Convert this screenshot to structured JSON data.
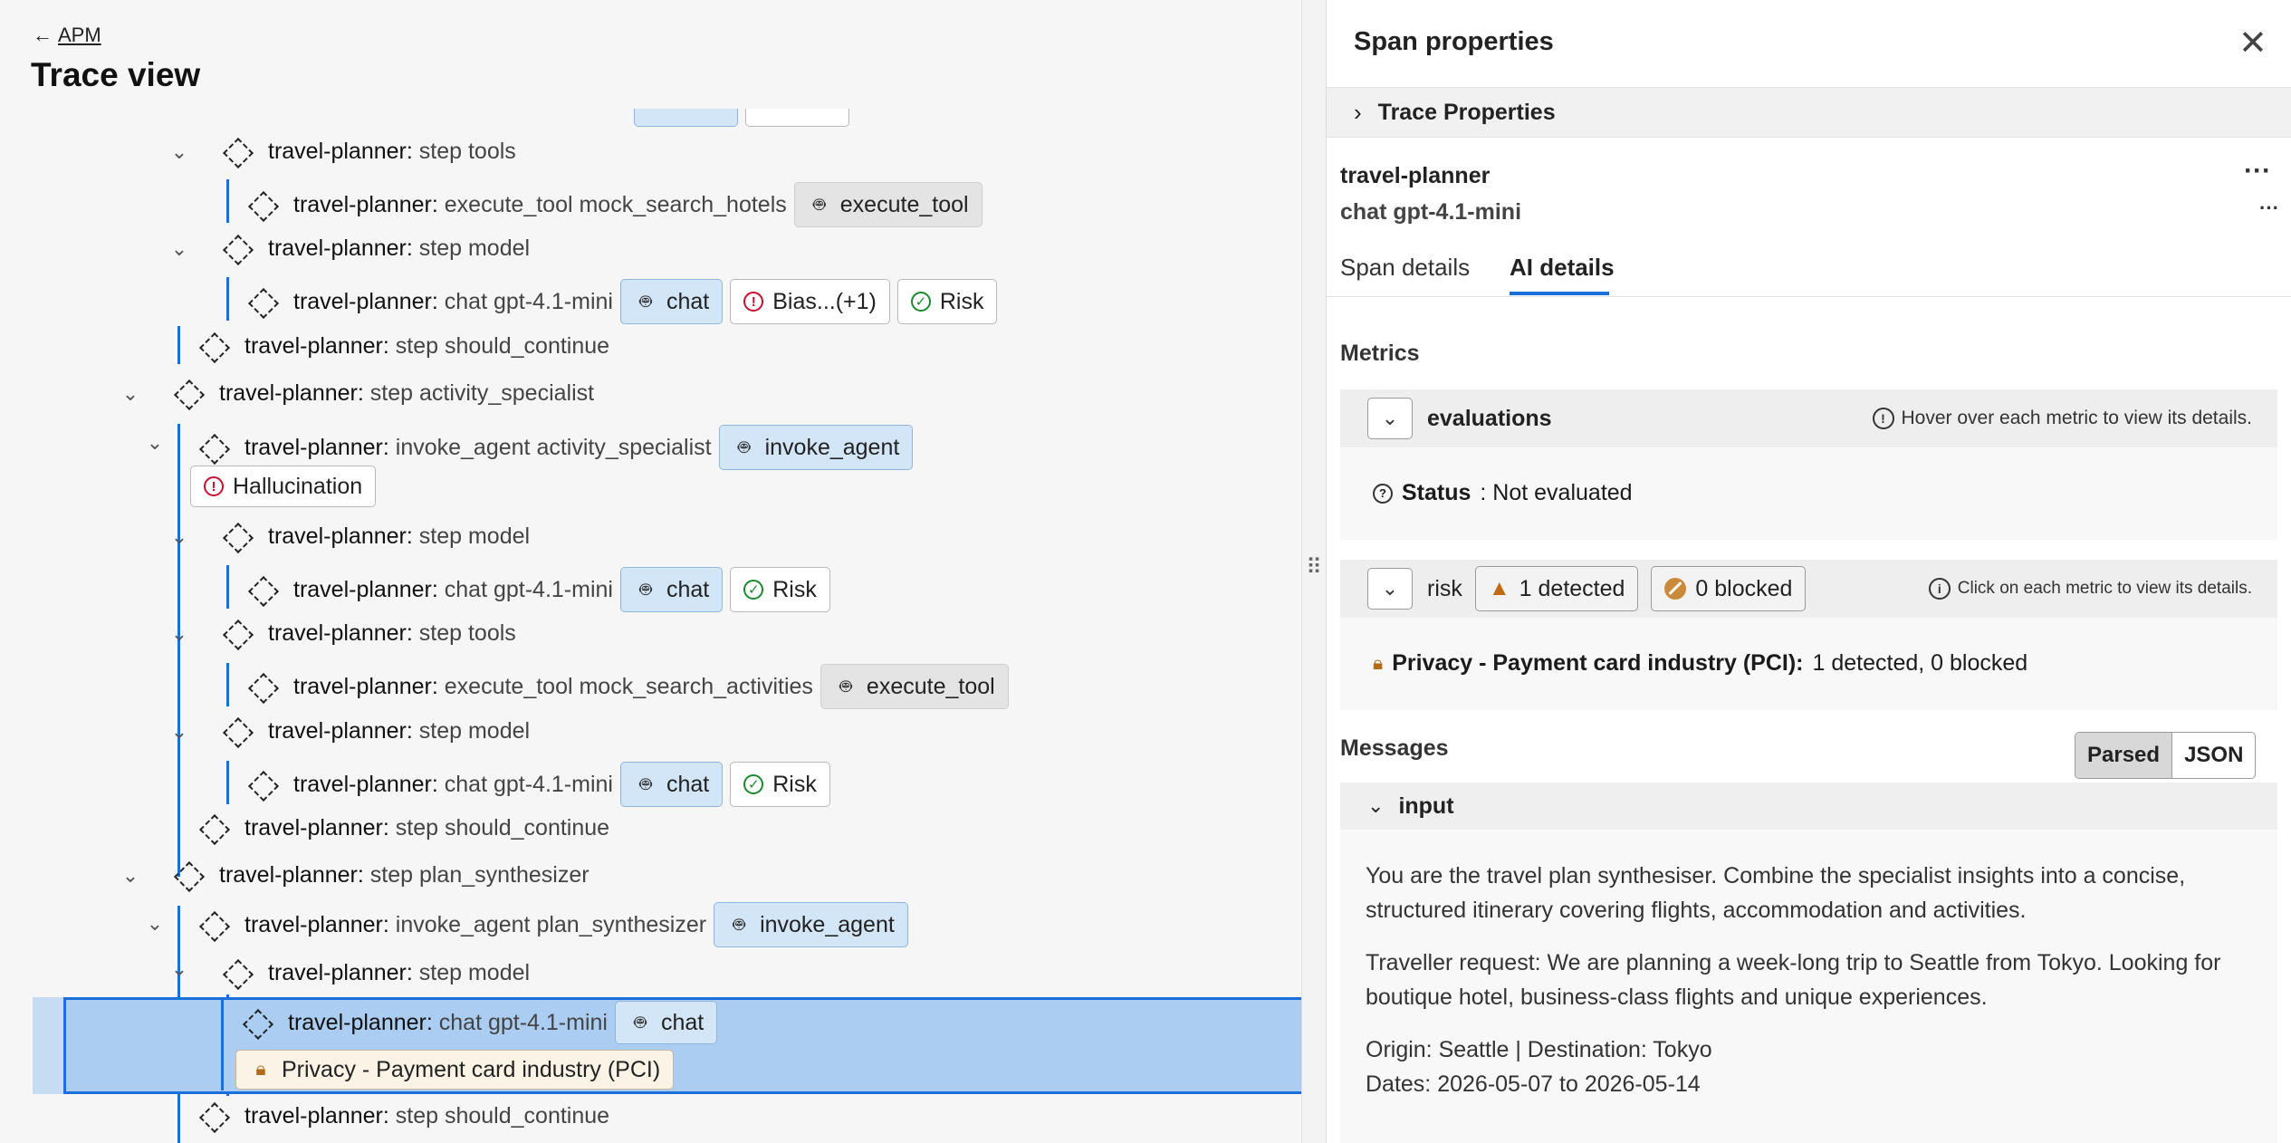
{
  "header": {
    "back_label": "APM",
    "title": "Trace view"
  },
  "tree_rows": [
    {
      "service": "travel-planner:",
      "op": "step tools"
    },
    {
      "service": "travel-planner:",
      "op": "execute_tool mock_search_hotels",
      "tags": [
        "execute_tool"
      ]
    },
    {
      "service": "travel-planner:",
      "op": "step model"
    },
    {
      "service": "travel-planner:",
      "op": "chat gpt-4.1-mini",
      "tags": [
        "chat",
        "Bias...(+1)",
        "Risk"
      ]
    },
    {
      "service": "travel-planner:",
      "op": "step should_continue"
    },
    {
      "service": "travel-planner:",
      "op": "step activity_specialist"
    },
    {
      "service": "travel-planner:",
      "op": "invoke_agent activity_specialist",
      "tags": [
        "invoke_agent",
        "Hallucination"
      ]
    },
    {
      "service": "travel-planner:",
      "op": "step model"
    },
    {
      "service": "travel-planner:",
      "op": "chat gpt-4.1-mini",
      "tags": [
        "chat",
        "Risk"
      ]
    },
    {
      "service": "travel-planner:",
      "op": "step tools"
    },
    {
      "service": "travel-planner:",
      "op": "execute_tool mock_search_activities",
      "tags": [
        "execute_tool"
      ]
    },
    {
      "service": "travel-planner:",
      "op": "step model"
    },
    {
      "service": "travel-planner:",
      "op": "chat gpt-4.1-mini",
      "tags": [
        "chat",
        "Risk"
      ]
    },
    {
      "service": "travel-planner:",
      "op": "step should_continue"
    },
    {
      "service": "travel-planner:",
      "op": "step plan_synthesizer"
    },
    {
      "service": "travel-planner:",
      "op": "invoke_agent plan_synthesizer",
      "tags": [
        "invoke_agent"
      ]
    },
    {
      "service": "travel-planner:",
      "op": "step model"
    },
    {
      "service": "travel-planner:",
      "op": "chat gpt-4.1-mini",
      "tags": [
        "chat",
        "Privacy - Payment card industry (PCI)"
      ],
      "selected": true
    },
    {
      "service": "travel-planner:",
      "op": "step should_continue"
    }
  ],
  "tag_labels": {
    "execute_tool": "execute_tool",
    "chat": "chat",
    "bias": "Bias...(+1)",
    "risk": "Risk",
    "invoke_agent": "invoke_agent",
    "hallucination": "Hallucination",
    "pci": "Privacy - Payment card industry (PCI)"
  },
  "panel": {
    "title": "Span properties",
    "trace_properties": "Trace Properties",
    "service": "travel-planner",
    "span_name": "chat gpt-4.1-mini",
    "tabs": [
      "Span details",
      "AI details"
    ],
    "active_tab": "AI details",
    "metrics_heading": "Metrics",
    "evaluations": {
      "name": "evaluations",
      "hint": "Hover over each metric to view its details.",
      "status_label": "Status",
      "status_value": ": Not evaluated"
    },
    "risk": {
      "name": "risk",
      "detected": "1 detected",
      "blocked": "0 blocked",
      "hint": "Click on each metric to view its details.",
      "item_label": "Privacy - Payment card industry (PCI):",
      "item_value": "1 detected, 0 blocked"
    },
    "messages_heading": "Messages",
    "view_modes": [
      "Parsed",
      "JSON"
    ],
    "active_view": "Parsed",
    "input_label": "input",
    "input_text": {
      "p1": "You are the travel plan synthesiser. Combine the specialist insights into a concise, structured itinerary covering flights, accommodation and activities.",
      "p2": "Traveller request: We are planning a week-long trip to Seattle from Tokyo. Looking for boutique hotel, business-class flights and unique experiences.",
      "p3a": "Origin: Seattle | Destination: Tokyo",
      "p3b": "Dates: 2026-05-07 to 2026-05-14"
    }
  },
  "colors": {
    "accent": "#1a6fd8",
    "selected_row": "#aacdf1",
    "chat_tag": "#d2e6f8"
  }
}
